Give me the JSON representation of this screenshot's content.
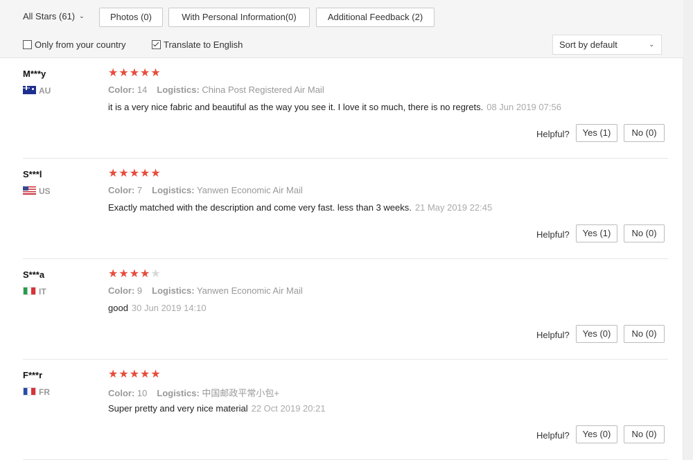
{
  "filters": {
    "all_stars": "All Stars (61)",
    "photos": "Photos (0)",
    "personal_info": "With Personal Information(0)",
    "additional": "Additional Feedback (2)"
  },
  "options": {
    "only_country": "Only from your country",
    "only_country_checked": false,
    "translate": "Translate to English",
    "translate_checked": true,
    "sort": "Sort by default"
  },
  "labels": {
    "color": "Color:",
    "logistics": "Logistics:",
    "helpful": "Helpful?"
  },
  "reviews": [
    {
      "user": "M***y",
      "country": "AU",
      "flag": "au",
      "rating": 5,
      "color": "14",
      "logistics": "China Post Registered Air Mail",
      "text": "it is a very nice fabric and beautiful as the way you see it. I love it so much, there is no regrets.",
      "date": "08 Jun 2019 07:56",
      "yes": "Yes (1)",
      "no": "No (0)"
    },
    {
      "user": "S***l",
      "country": "US",
      "flag": "us",
      "rating": 5,
      "color": "7",
      "logistics": "Yanwen Economic Air Mail",
      "text": "Exactly matched with the description and come very fast. less than 3 weeks.",
      "date": "21 May 2019 22:45",
      "yes": "Yes (1)",
      "no": "No (0)"
    },
    {
      "user": "S***a",
      "country": "IT",
      "flag": "it",
      "rating": 4,
      "color": "9",
      "logistics": "Yanwen Economic Air Mail",
      "text": "good",
      "date": "30 Jun 2019 14:10",
      "yes": "Yes (0)",
      "no": "No (0)"
    },
    {
      "user": "F***r",
      "country": "FR",
      "flag": "fr",
      "rating": 5,
      "color": "10",
      "logistics": "中国邮政平常小包+",
      "text": "Super pretty and very nice material",
      "date": "22 Oct 2019 20:21",
      "yes": "Yes (0)",
      "no": "No (0)"
    }
  ]
}
